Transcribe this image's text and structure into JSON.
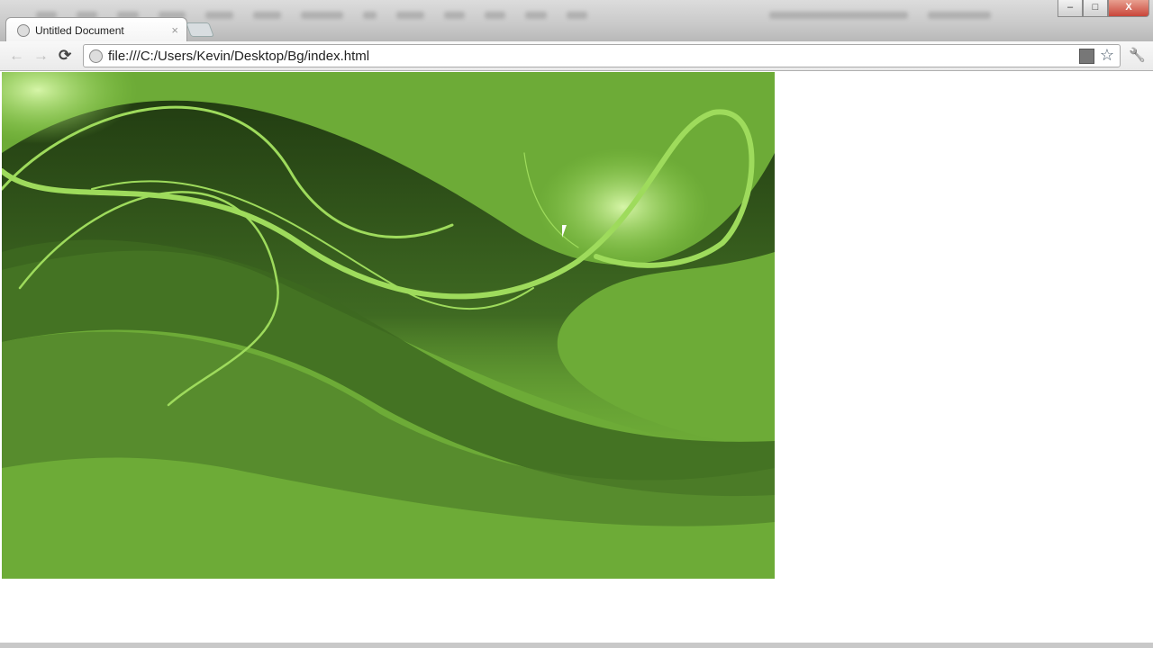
{
  "browser": {
    "tab_title": "Untitled Document",
    "tab_close": "×",
    "url": "file:///C:/Users/Kevin/Desktop/Bg/index.html",
    "back_icon": "←",
    "forward_icon": "→",
    "reload_icon": "⟳",
    "star_icon": "☆",
    "wrench_icon": "🔧",
    "window_controls": {
      "minimize": "–",
      "maximize": "□",
      "close": "X"
    }
  },
  "colors": {
    "bg_green": "#6dab37",
    "dark_green": "#2c4a18",
    "light_green": "#a9dc6a"
  }
}
